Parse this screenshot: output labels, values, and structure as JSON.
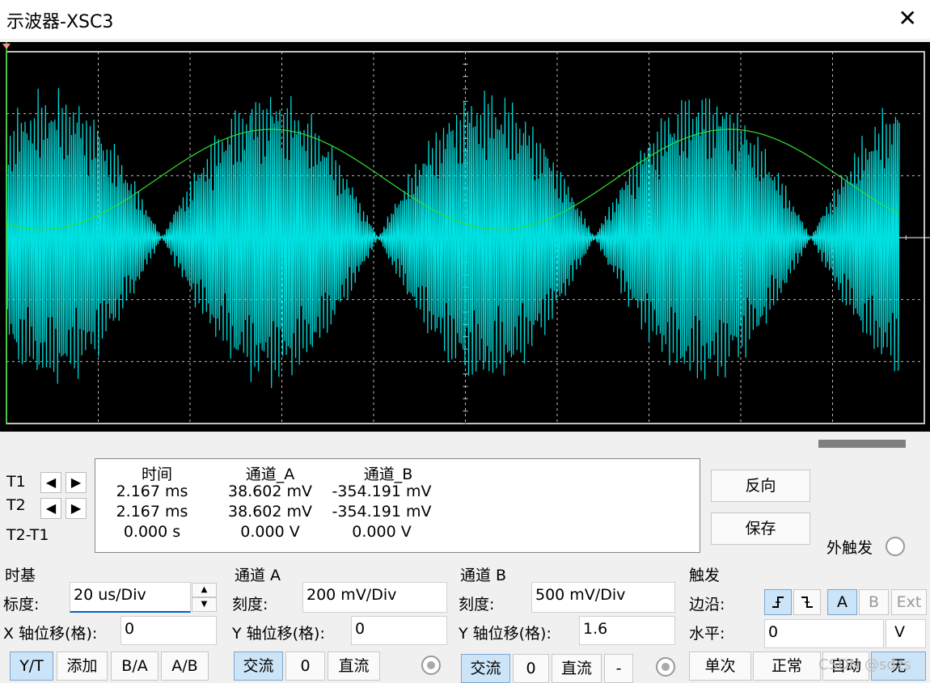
{
  "window": {
    "title": "示波器-XSC3"
  },
  "readout": {
    "headers": [
      "时间",
      "通道_A",
      "通道_B"
    ],
    "rows": [
      {
        "label": "T1",
        "time": "2.167 ms",
        "a": "38.602 mV",
        "b": "-354.191 mV"
      },
      {
        "label": "T2",
        "time": "2.167 ms",
        "a": "38.602 mV",
        "b": "-354.191 mV"
      },
      {
        "label": "T2-T1",
        "time": "0.000 s",
        "a": "0.000 V",
        "b": "0.000 V"
      }
    ]
  },
  "side": {
    "reverse_label": "反向",
    "save_label": "保存",
    "ext_trigger_label": "外触发"
  },
  "timebase": {
    "title": "时基",
    "scale_label": "标度:",
    "scale_value": "20 us/Div",
    "xpos_label": "X 轴位移(格):",
    "xpos_value": "0",
    "modes": [
      "Y/T",
      "添加",
      "B/A",
      "A/B"
    ]
  },
  "channel_a": {
    "title": "通道 A",
    "scale_label": "刻度:",
    "scale_value": "200 mV/Div",
    "ypos_label": "Y 轴位移(格):",
    "ypos_value": "0",
    "coupling": [
      "交流",
      "0",
      "直流"
    ]
  },
  "channel_b": {
    "title": "通道 B",
    "scale_label": "刻度:",
    "scale_value": "500 mV/Div",
    "ypos_label": "Y 轴位移(格):",
    "ypos_value": "1.6",
    "coupling": [
      "交流",
      "0",
      "直流",
      "-"
    ]
  },
  "trigger": {
    "title": "触发",
    "edge_label": "边沿:",
    "sources": [
      "A",
      "B",
      "Ext"
    ],
    "level_label": "水平:",
    "level_value": "0",
    "level_unit": "V",
    "modes": [
      "单次",
      "正常",
      "自动",
      "无"
    ]
  },
  "watermark": "CSDN @sdzs",
  "colors": {
    "trace_a": "#00e0e0",
    "trace_b": "#33dd33",
    "grid": "#bfbfbf",
    "screen": "#000000"
  },
  "icons": {
    "close": "close-icon",
    "left": "arrow-left-icon",
    "right": "arrow-right-icon",
    "rise": "rising-edge-icon",
    "fall": "falling-edge-icon"
  }
}
